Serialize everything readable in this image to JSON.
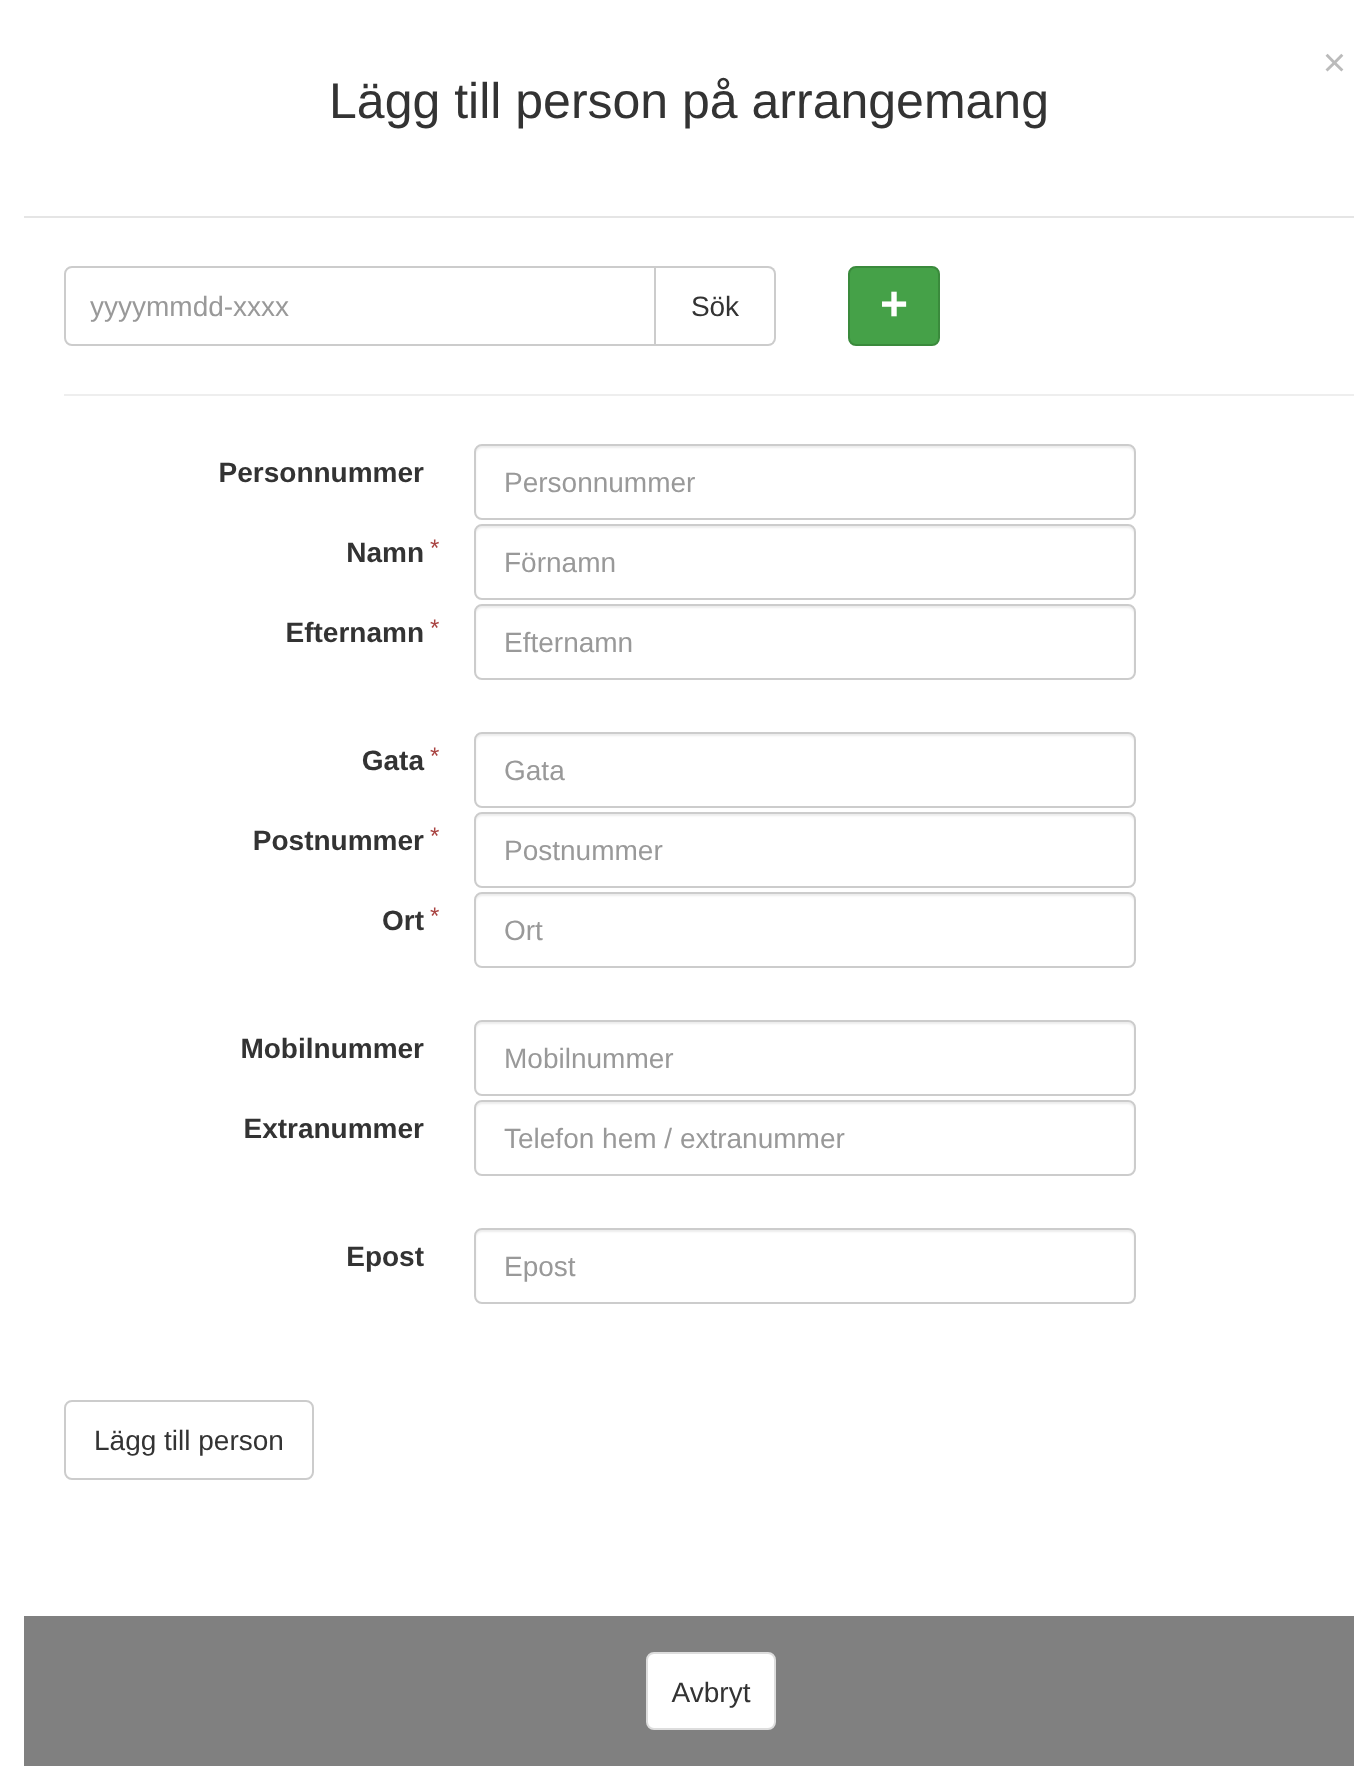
{
  "dialog": {
    "title": "Lägg till person på arrangemang",
    "close": "×"
  },
  "search": {
    "placeholder": "yyyymmdd-xxxx",
    "button": "Sök",
    "add_button": "+"
  },
  "field_groups": [
    {
      "fields": [
        {
          "label": "Personnummer",
          "required": false,
          "placeholder": "Personnummer"
        },
        {
          "label": "Namn",
          "required": true,
          "placeholder": "Förnamn"
        },
        {
          "label": "Efternamn",
          "required": true,
          "placeholder": "Efternamn"
        }
      ]
    },
    {
      "fields": [
        {
          "label": "Gata",
          "required": true,
          "placeholder": "Gata"
        },
        {
          "label": "Postnummer",
          "required": true,
          "placeholder": "Postnummer"
        },
        {
          "label": "Ort",
          "required": true,
          "placeholder": "Ort"
        }
      ]
    },
    {
      "fields": [
        {
          "label": "Mobilnummer",
          "required": false,
          "placeholder": "Mobilnummer"
        },
        {
          "label": "Extranummer",
          "required": false,
          "placeholder": "Telefon hem / extranummer"
        }
      ]
    },
    {
      "fields": [
        {
          "label": "Epost",
          "required": false,
          "placeholder": "Epost"
        }
      ]
    }
  ],
  "required_mark": "*",
  "submit_button": "Lägg till person",
  "footer": {
    "cancel_button": "Avbryt"
  }
}
